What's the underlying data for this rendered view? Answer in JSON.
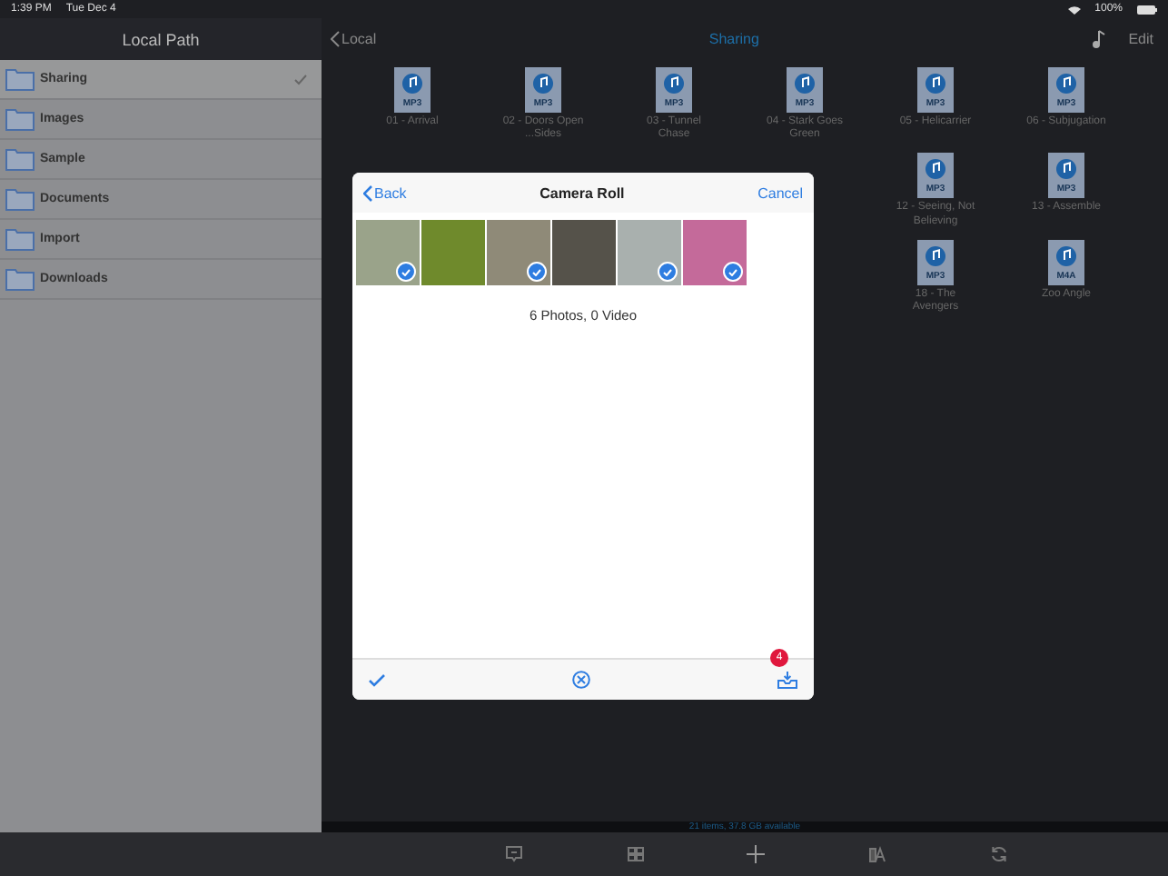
{
  "status_bar": {
    "time": "1:39 PM",
    "date": "Tue Dec 4",
    "battery": "100%"
  },
  "sidebar": {
    "title": "Local Path",
    "items": [
      {
        "label": "Sharing",
        "selected": true
      },
      {
        "label": "Images",
        "selected": false
      },
      {
        "label": "Sample",
        "selected": false
      },
      {
        "label": "Documents",
        "selected": false
      },
      {
        "label": "Import",
        "selected": false
      },
      {
        "label": "Downloads",
        "selected": false
      }
    ]
  },
  "header": {
    "back": "Local",
    "title": "Sharing",
    "edit": "Edit"
  },
  "file_rows": [
    [
      {
        "type": "MP3",
        "name": "01 - Arrival"
      },
      {
        "type": "MP3",
        "name": "02 - Doors Open ...Sides"
      },
      {
        "type": "MP3",
        "name": "03 - Tunnel Chase"
      },
      {
        "type": "MP3",
        "name": "04 - Stark Goes Green"
      },
      {
        "type": "MP3",
        "name": "05 - Helicarrier"
      },
      {
        "type": "MP3",
        "name": "06 - Subjugation"
      }
    ],
    [
      {
        "type": "MP3",
        "name": "12 - Seeing, Not Believing"
      },
      {
        "type": "MP3",
        "name": "13 - Assemble"
      }
    ],
    [
      {
        "type": "MP3",
        "name": "18 - The Avengers"
      },
      {
        "type": "M4A",
        "name": "Zoo Angle"
      }
    ]
  ],
  "dialog": {
    "back": "Back",
    "title": "Camera Roll",
    "cancel": "Cancel",
    "photos": [
      {
        "color": "#9aa38a",
        "selected": true
      },
      {
        "color": "#6f8a2c",
        "selected": false
      },
      {
        "color": "#8f8a78",
        "selected": true
      },
      {
        "color": "#55524a",
        "selected": false
      },
      {
        "color": "#a9b0ae",
        "selected": true
      },
      {
        "color": "#c46a9a",
        "selected": true
      }
    ],
    "summary": "6 Photos, 0 Video",
    "badge": "4"
  },
  "storage": "21 items, 37.8 GB available"
}
